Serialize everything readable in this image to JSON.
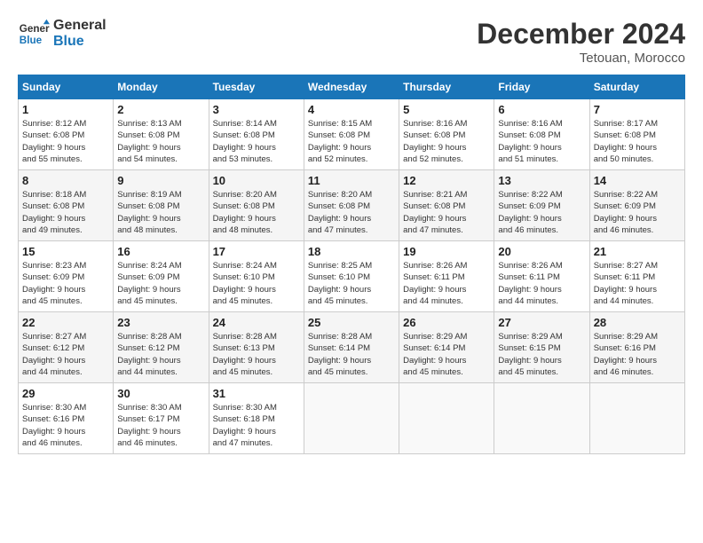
{
  "header": {
    "logo_line1": "General",
    "logo_line2": "Blue",
    "month": "December 2024",
    "location": "Tetouan, Morocco"
  },
  "columns": [
    "Sunday",
    "Monday",
    "Tuesday",
    "Wednesday",
    "Thursday",
    "Friday",
    "Saturday"
  ],
  "weeks": [
    [
      {
        "day": "1",
        "detail": "Sunrise: 8:12 AM\nSunset: 6:08 PM\nDaylight: 9 hours\nand 55 minutes."
      },
      {
        "day": "2",
        "detail": "Sunrise: 8:13 AM\nSunset: 6:08 PM\nDaylight: 9 hours\nand 54 minutes."
      },
      {
        "day": "3",
        "detail": "Sunrise: 8:14 AM\nSunset: 6:08 PM\nDaylight: 9 hours\nand 53 minutes."
      },
      {
        "day": "4",
        "detail": "Sunrise: 8:15 AM\nSunset: 6:08 PM\nDaylight: 9 hours\nand 52 minutes."
      },
      {
        "day": "5",
        "detail": "Sunrise: 8:16 AM\nSunset: 6:08 PM\nDaylight: 9 hours\nand 52 minutes."
      },
      {
        "day": "6",
        "detail": "Sunrise: 8:16 AM\nSunset: 6:08 PM\nDaylight: 9 hours\nand 51 minutes."
      },
      {
        "day": "7",
        "detail": "Sunrise: 8:17 AM\nSunset: 6:08 PM\nDaylight: 9 hours\nand 50 minutes."
      }
    ],
    [
      {
        "day": "8",
        "detail": "Sunrise: 8:18 AM\nSunset: 6:08 PM\nDaylight: 9 hours\nand 49 minutes."
      },
      {
        "day": "9",
        "detail": "Sunrise: 8:19 AM\nSunset: 6:08 PM\nDaylight: 9 hours\nand 48 minutes."
      },
      {
        "day": "10",
        "detail": "Sunrise: 8:20 AM\nSunset: 6:08 PM\nDaylight: 9 hours\nand 48 minutes."
      },
      {
        "day": "11",
        "detail": "Sunrise: 8:20 AM\nSunset: 6:08 PM\nDaylight: 9 hours\nand 47 minutes."
      },
      {
        "day": "12",
        "detail": "Sunrise: 8:21 AM\nSunset: 6:08 PM\nDaylight: 9 hours\nand 47 minutes."
      },
      {
        "day": "13",
        "detail": "Sunrise: 8:22 AM\nSunset: 6:09 PM\nDaylight: 9 hours\nand 46 minutes."
      },
      {
        "day": "14",
        "detail": "Sunrise: 8:22 AM\nSunset: 6:09 PM\nDaylight: 9 hours\nand 46 minutes."
      }
    ],
    [
      {
        "day": "15",
        "detail": "Sunrise: 8:23 AM\nSunset: 6:09 PM\nDaylight: 9 hours\nand 45 minutes."
      },
      {
        "day": "16",
        "detail": "Sunrise: 8:24 AM\nSunset: 6:09 PM\nDaylight: 9 hours\nand 45 minutes."
      },
      {
        "day": "17",
        "detail": "Sunrise: 8:24 AM\nSunset: 6:10 PM\nDaylight: 9 hours\nand 45 minutes."
      },
      {
        "day": "18",
        "detail": "Sunrise: 8:25 AM\nSunset: 6:10 PM\nDaylight: 9 hours\nand 45 minutes."
      },
      {
        "day": "19",
        "detail": "Sunrise: 8:26 AM\nSunset: 6:11 PM\nDaylight: 9 hours\nand 44 minutes."
      },
      {
        "day": "20",
        "detail": "Sunrise: 8:26 AM\nSunset: 6:11 PM\nDaylight: 9 hours\nand 44 minutes."
      },
      {
        "day": "21",
        "detail": "Sunrise: 8:27 AM\nSunset: 6:11 PM\nDaylight: 9 hours\nand 44 minutes."
      }
    ],
    [
      {
        "day": "22",
        "detail": "Sunrise: 8:27 AM\nSunset: 6:12 PM\nDaylight: 9 hours\nand 44 minutes."
      },
      {
        "day": "23",
        "detail": "Sunrise: 8:28 AM\nSunset: 6:12 PM\nDaylight: 9 hours\nand 44 minutes."
      },
      {
        "day": "24",
        "detail": "Sunrise: 8:28 AM\nSunset: 6:13 PM\nDaylight: 9 hours\nand 45 minutes."
      },
      {
        "day": "25",
        "detail": "Sunrise: 8:28 AM\nSunset: 6:14 PM\nDaylight: 9 hours\nand 45 minutes."
      },
      {
        "day": "26",
        "detail": "Sunrise: 8:29 AM\nSunset: 6:14 PM\nDaylight: 9 hours\nand 45 minutes."
      },
      {
        "day": "27",
        "detail": "Sunrise: 8:29 AM\nSunset: 6:15 PM\nDaylight: 9 hours\nand 45 minutes."
      },
      {
        "day": "28",
        "detail": "Sunrise: 8:29 AM\nSunset: 6:16 PM\nDaylight: 9 hours\nand 46 minutes."
      }
    ],
    [
      {
        "day": "29",
        "detail": "Sunrise: 8:30 AM\nSunset: 6:16 PM\nDaylight: 9 hours\nand 46 minutes."
      },
      {
        "day": "30",
        "detail": "Sunrise: 8:30 AM\nSunset: 6:17 PM\nDaylight: 9 hours\nand 46 minutes."
      },
      {
        "day": "31",
        "detail": "Sunrise: 8:30 AM\nSunset: 6:18 PM\nDaylight: 9 hours\nand 47 minutes."
      },
      {
        "day": "",
        "detail": ""
      },
      {
        "day": "",
        "detail": ""
      },
      {
        "day": "",
        "detail": ""
      },
      {
        "day": "",
        "detail": ""
      }
    ]
  ]
}
